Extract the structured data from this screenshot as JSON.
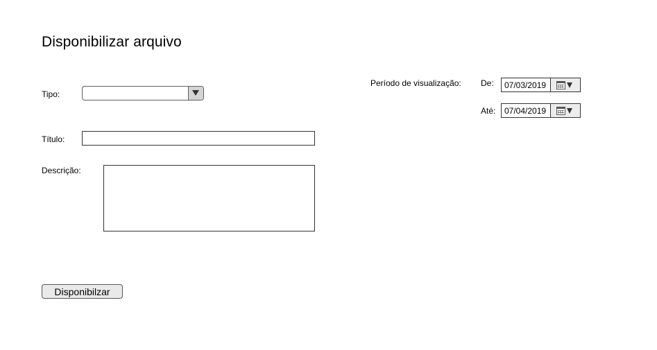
{
  "page": {
    "title": "Disponibilizar arquivo"
  },
  "form": {
    "tipo": {
      "label": "Tipo:",
      "value": ""
    },
    "titulo": {
      "label": "Título:",
      "value": ""
    },
    "descricao": {
      "label": "Descrição:",
      "value": ""
    },
    "periodo": {
      "label": "Período de visualização:",
      "de": {
        "label": "De:",
        "value": "07/03/2019",
        "icon": "calendar-icon"
      },
      "ate": {
        "label": "Até:",
        "value": "07/04/2019",
        "icon": "calendar-icon"
      }
    },
    "submit_label": "Disponibilzar"
  }
}
